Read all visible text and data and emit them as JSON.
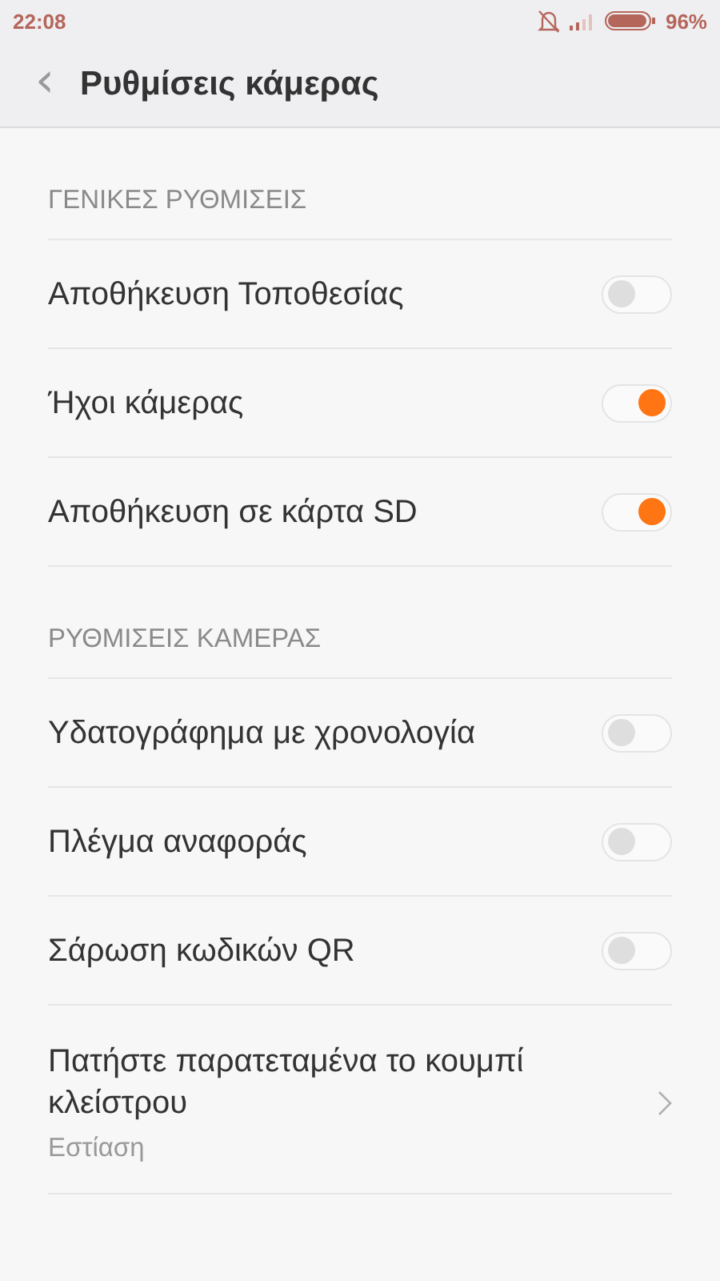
{
  "status_bar": {
    "time": "22:08",
    "battery_text": "96%",
    "battery": {
      "level": 0.96
    }
  },
  "header": {
    "back_icon": "‹",
    "title": "Ρυθμίσεις κάμερας"
  },
  "sections": [
    {
      "title": "ΓΕΝΙΚΕΣ ΡΥΘΜΙΣΕΙΣ",
      "items": [
        {
          "kind": "toggle",
          "label": "Αποθήκευση Τοποθεσίας",
          "on": false
        },
        {
          "kind": "toggle",
          "label": "Ήχοι κάμερας",
          "on": true
        },
        {
          "kind": "toggle",
          "label": "Αποθήκευση σε κάρτα SD",
          "on": true
        }
      ]
    },
    {
      "title": "ΡΥΘΜΙΣΕΙΣ ΚΑΜΕΡΑΣ",
      "items": [
        {
          "kind": "toggle",
          "label": "Υδατογράφημα με χρονολογία",
          "on": false
        },
        {
          "kind": "toggle",
          "label": "Πλέγμα αναφοράς",
          "on": false
        },
        {
          "kind": "toggle",
          "label": "Σάρωση κωδικών QR",
          "on": false
        },
        {
          "kind": "link",
          "label": "Πατήστε παρατεταμένα το κουμπί κλείστρου",
          "value": "Εστίαση"
        }
      ]
    }
  ]
}
